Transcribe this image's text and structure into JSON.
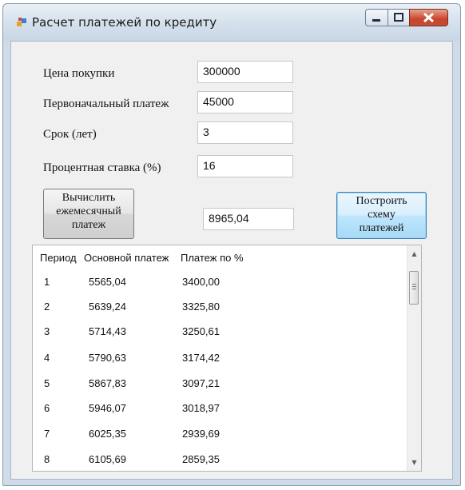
{
  "window": {
    "title": "Расчет платежей по кредиту"
  },
  "icons": {
    "app": "app-icon",
    "minimize": "minimize-icon",
    "maximize": "maximize-icon",
    "close": "close-icon"
  },
  "form": {
    "price_label": "Цена покупки",
    "price_value": "300000",
    "down_payment_label": "Первоначальный платеж",
    "down_payment_value": "45000",
    "term_label": "Срок (лет)",
    "term_value": "3",
    "rate_label": "Процентная ставка (%)",
    "rate_value": "16",
    "calc_button_line1": "Вычислить",
    "calc_button_line2": "ежемесячный",
    "calc_button_line3": "платеж",
    "monthly_payment_value": "8965,04",
    "schedule_button_line1": "Построить",
    "schedule_button_line2": "схему",
    "schedule_button_line3": "платежей"
  },
  "table": {
    "headers": [
      "Период",
      "Основной платеж",
      "Платеж по %"
    ],
    "rows": [
      [
        "1",
        "5565,04",
        "3400,00"
      ],
      [
        "2",
        "5639,24",
        "3325,80"
      ],
      [
        "3",
        "5714,43",
        "3250,61"
      ],
      [
        "4",
        "5790,63",
        "3174,42"
      ],
      [
        "5",
        "5867,83",
        "3097,21"
      ],
      [
        "6",
        "5946,07",
        "3018,97"
      ],
      [
        "7",
        "6025,35",
        "2939,69"
      ],
      [
        "8",
        "6105,69",
        "2859,35"
      ]
    ]
  },
  "colors": {
    "close_button": "#c9452b",
    "window_frame": "#cfdbe9",
    "client_bg": "#f0f0f0"
  }
}
